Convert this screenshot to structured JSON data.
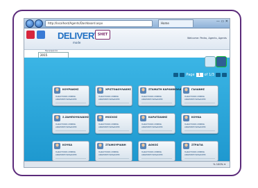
{
  "browser": {
    "address": "http://localhost/Agents/Dashboard.aspx",
    "tab_title": "Home",
    "window_buttons": "— ▭ ✕",
    "zoom": "% 100% ▾"
  },
  "header": {
    "logo": "DELIVERY",
    "logo_sub": "mode",
    "brand_logo": "SHET",
    "welcome": "Welcome: Pedro, Agents, Agents"
  },
  "toolbar": {
    "date_label": "Ημερομηνία",
    "date_value": "2015"
  },
  "pager": {
    "label": "Page",
    "current": "1",
    "of_text": "of 1/3"
  },
  "cards": [
    {
      "name": "ΚΟΥΡΙΑΚΗΣ",
      "line1": "ΠΑΡΑΓΓΕΛΙΕΣ ΣΗΜΕΡΑ",
      "line2": "ΑΝΑΜΟΝΗ ΠΑΡΑΔΟΣΗΣ"
    },
    {
      "name": "ΧΡΙΣΤΟΔΟΥΛΑΚΗΣ",
      "line1": "ΠΑΡΑΓΓΕΛΙΕΣ ΣΗΜΕΡΑ",
      "line2": "ΑΝΑΜΟΝΗ ΠΑΡΑΔΟΣΗΣ"
    },
    {
      "name": "ΣΤΑΜΑΤΗ ΚΑΡΑΝΙΚΟΛΑ",
      "line1": "ΠΑΡΑΓΓΕΛΙΕΣ ΣΗΜΕΡΑ",
      "line2": "ΑΝΑΜΟΝΗ ΠΑΡΑΔΟΣΗΣ"
    },
    {
      "name": "ΓΑΛΑΝΗΣ",
      "line1": "ΠΑΡΑΓΓΕΛΙΕΣ ΣΗΜΕΡΑ",
      "line2": "ΑΝΑΜΟΝΗ ΠΑΡΑΔΟΣΗΣ"
    },
    {
      "name": "Σ.ΖΑΜΠΟΥΚΛΑΚΗΣ",
      "line1": "ΠΑΡΑΓΓΕΛΙΕΣ ΣΗΜΕΡΑ",
      "line2": "ΑΝΑΜΟΝΗ ΠΑΡΑΔΟΣΗΣ"
    },
    {
      "name": "ΜΟΣΧΟΣ",
      "line1": "ΠΑΡΑΓΓΕΛΙΕΣ ΣΗΜΕΡΑ",
      "line2": "ΑΝΑΜΟΝΗ ΠΑΡΑΔΟΣΗΣ"
    },
    {
      "name": "ΚΑΡΑΤΖΑΝΗΣ",
      "line1": "ΠΑΡΑΓΓΕΛΙΕΣ ΣΗΜΕΡΑ",
      "line2": "ΑΝΑΜΟΝΗ ΠΑΡΑΔΟΣΗΣ"
    },
    {
      "name": "ΚΟΥΚΑ",
      "line1": "ΠΑΡΑΓΓΕΛΙΕΣ ΣΗΜΕΡΑ",
      "line2": "ΑΝΑΜΟΝΗ ΠΑΡΑΔΟΣΗΣ"
    },
    {
      "name": "ΚΟΥΚΑ",
      "line1": "ΠΑΡΑΓΓΕΛΙΕΣ ΣΗΜΕΡΑ",
      "line2": "ΑΝΑΜΟΝΗ ΠΑΡΑΔΟΣΗΣ"
    },
    {
      "name": "ΣΤΑΜΟΥΡΙΑΝΗ",
      "line1": "ΠΑΡΑΓΓΕΛΙΕΣ ΣΗΜΕΡΑ",
      "line2": "ΑΝΑΜΟΝΗ ΠΑΡΑΔΟΣΗΣ"
    },
    {
      "name": "ΔΟΚΟΣ",
      "line1": "ΠΑΡΑΓΓΕΛΙΕΣ ΣΗΜΕΡΑ",
      "line2": "ΑΝΑΜΟΝΗ ΠΑΡΑΔΟΣΗΣ"
    },
    {
      "name": "ΣΤΡΑΓΙΑ",
      "line1": "ΠΑΡΑΓΓΕΛΙΕΣ ΣΗΜΕΡΑ",
      "line2": "ΑΝΑΜΟΝΗ ΠΑΡΑΔΟΣΗΣ"
    }
  ],
  "colors": {
    "frame": "#5b2a7a",
    "content_bg": "#2aa8dd",
    "logo_blue": "#1f6fc2"
  }
}
